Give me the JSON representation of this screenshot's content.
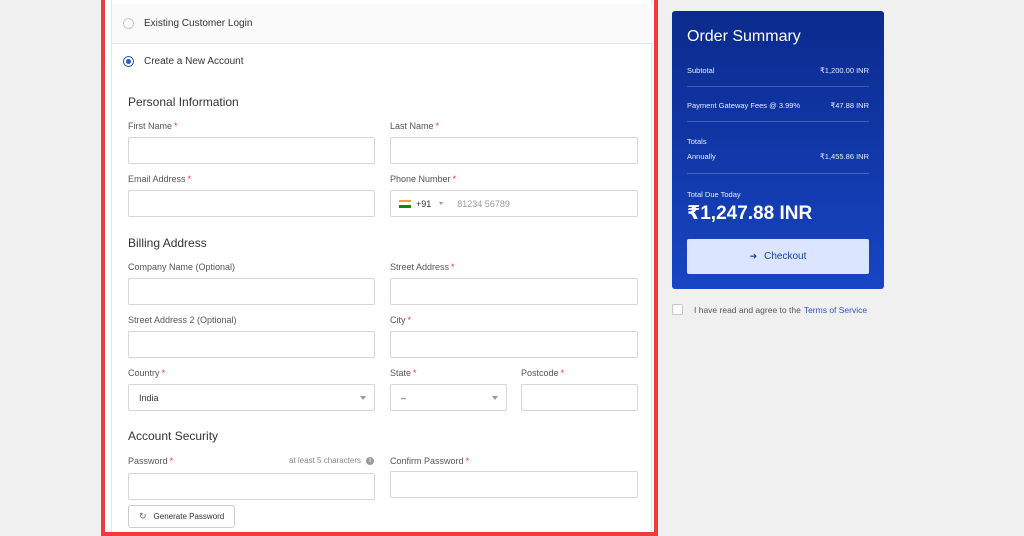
{
  "login_options": {
    "existing": "Existing Customer Login",
    "create": "Create a New Account"
  },
  "sections": {
    "personal": "Personal Information",
    "billing": "Billing Address",
    "security": "Account Security"
  },
  "fields": {
    "first_name": "First Name",
    "last_name": "Last Name",
    "email": "Email Address",
    "phone": "Phone Number",
    "company": "Company Name (Optional)",
    "street": "Street Address",
    "street2": "Street Address 2 (Optional)",
    "city": "City",
    "country": "Country",
    "state": "State",
    "postcode": "Postcode",
    "password": "Password",
    "confirm_password": "Confirm Password",
    "required_mark": "*"
  },
  "phone": {
    "code": "+91",
    "placeholder": "81234 56789"
  },
  "selects": {
    "country_value": "India",
    "state_value": "–"
  },
  "password_hint": "at least 5 characters",
  "generate_password": "Generate Password",
  "summary": {
    "title": "Order Summary",
    "subtotal_label": "Subtotal",
    "subtotal_value": "₹1,200.00 INR",
    "fee_label": "Payment Gateway Fees @ 3.99%",
    "fee_value": "₹47.88 INR",
    "totals_label": "Totals",
    "annually_label": "Annually",
    "annually_value": "₹1,455.86 INR",
    "due_label": "Total Due Today",
    "due_value": "₹1,247.88 INR",
    "checkout_label": "Checkout"
  },
  "tos": {
    "text": "I have read and agree to the",
    "link": "Terms of Service"
  },
  "colors": {
    "accent": "#2a56c6",
    "highlight_border": "#ee3b3b",
    "summary_top": "#0b2a8c",
    "summary_bottom": "#1745c4"
  }
}
